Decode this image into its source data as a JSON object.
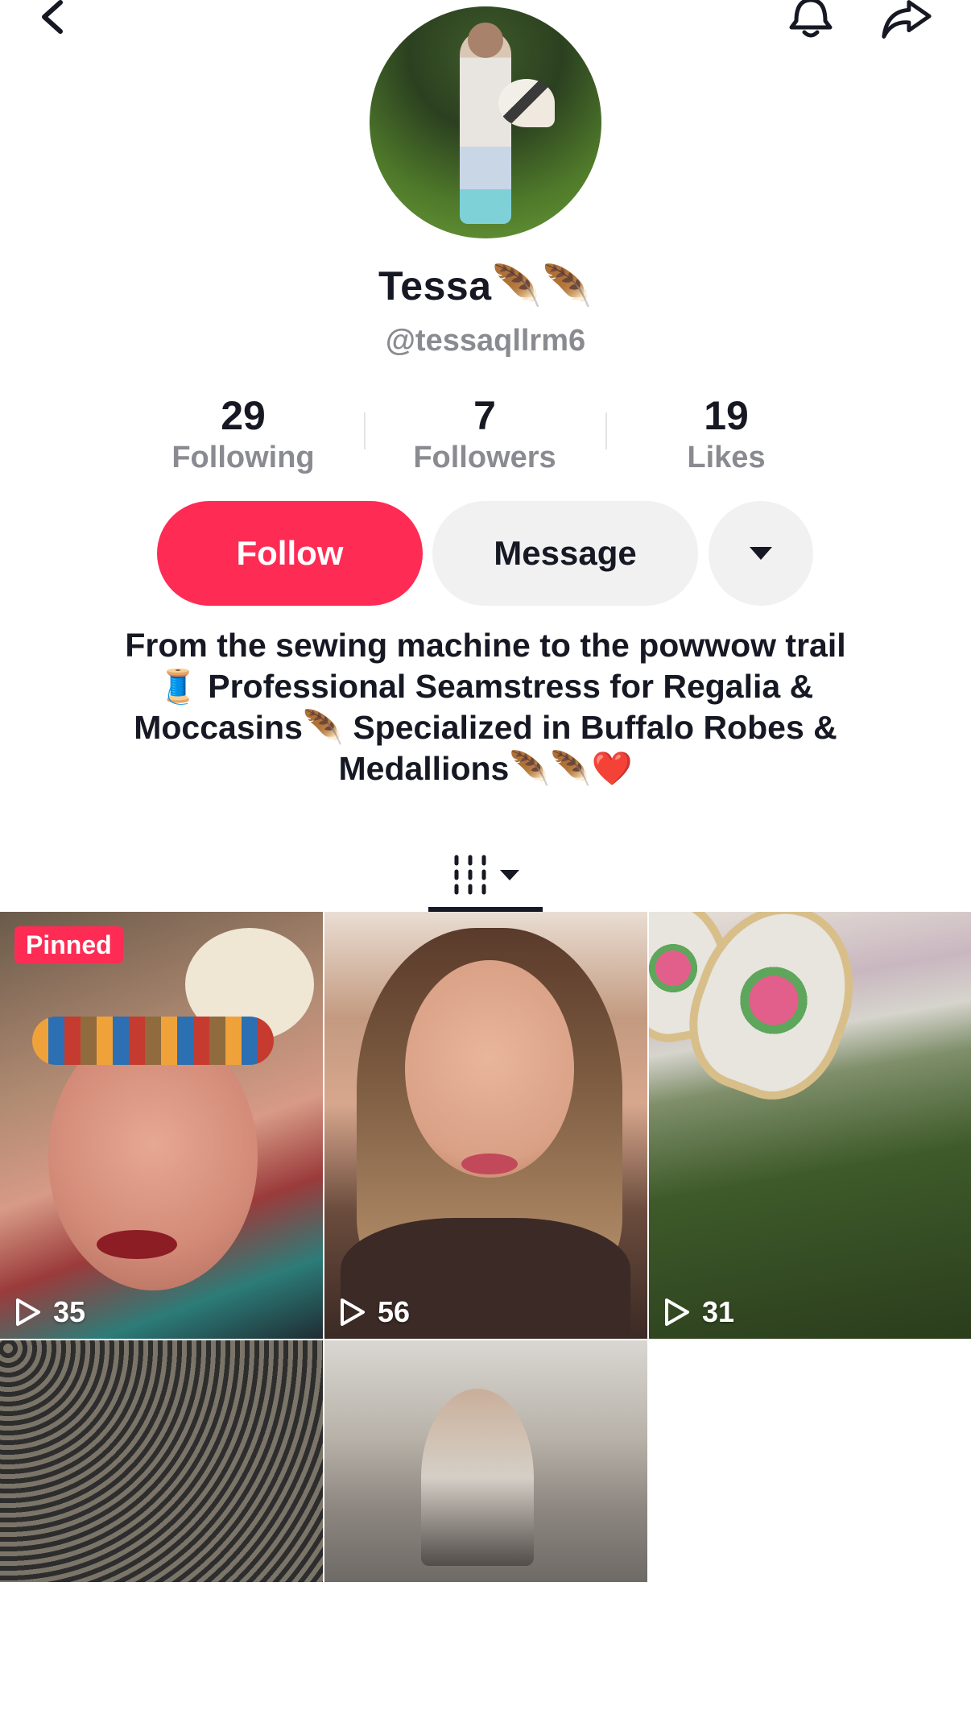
{
  "header": {
    "back_icon": "chevron-left-icon",
    "notification_icon": "bell-icon",
    "share_icon": "share-arrow-icon"
  },
  "profile": {
    "name": "Tessa🪶🪶",
    "handle": "@tessaqllrm6",
    "stats": [
      {
        "value": "29",
        "label": "Following"
      },
      {
        "value": "7",
        "label": "Followers"
      },
      {
        "value": "19",
        "label": "Likes"
      }
    ],
    "buttons": {
      "follow": "Follow",
      "message": "Message",
      "more_icon": "caret-down-icon"
    },
    "bio": [
      "From the sewing machine to the powwow trail",
      "🧵 Professional Seamstress for Regalia &",
      "Moccasins🪶 Specialized in Buffalo Robes &",
      "Medallions🪶🪶❤️"
    ]
  },
  "tabs": {
    "videos_icon": "grid-bars-icon",
    "dropdown_icon": "caret-down-icon"
  },
  "videos": [
    {
      "badge": "Pinned",
      "plays": "35"
    },
    {
      "badge": "",
      "plays": "56"
    },
    {
      "badge": "",
      "plays": "31"
    },
    {
      "badge": "",
      "plays": ""
    },
    {
      "badge": "",
      "plays": ""
    }
  ],
  "colors": {
    "accent": "#fe2c55",
    "text": "#161823",
    "muted": "#8a8b91",
    "button_bg": "#f1f1f2"
  }
}
